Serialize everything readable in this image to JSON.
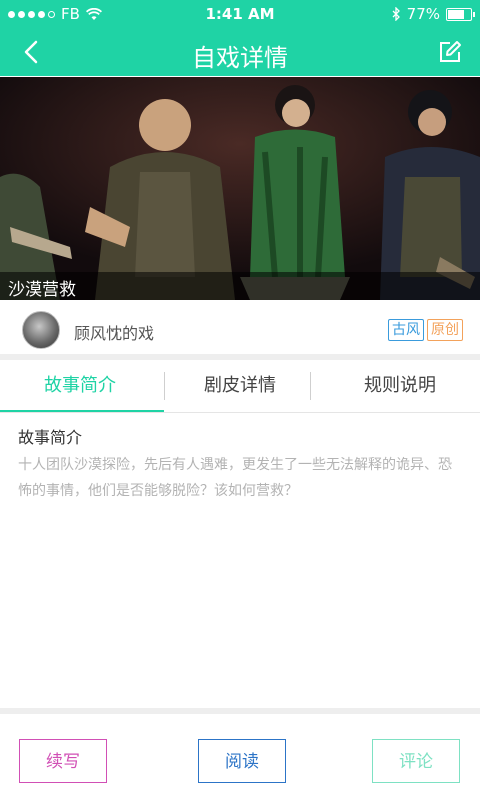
{
  "status_bar": {
    "carrier": "FB",
    "time": "1:41 AM",
    "battery_percent": "77%",
    "battery_level": 0.77,
    "signal_bars_filled": 4,
    "signal_bars_total": 5
  },
  "header": {
    "title": "自戏详情",
    "back_icon": "chevron-left-icon",
    "edit_icon": "edit-icon"
  },
  "hero": {
    "caption": "沙漠营救"
  },
  "author": {
    "name": "顾风忱的戏",
    "tags": [
      "古风",
      "原创"
    ]
  },
  "tabs": [
    {
      "label": "故事简介",
      "active": true
    },
    {
      "label": "剧皮详情",
      "active": false
    },
    {
      "label": "规则说明",
      "active": false
    }
  ],
  "intro": {
    "heading": "故事简介",
    "text": "十人团队沙漠探险，先后有人遇难，更发生了一些无法解释的诡异、恐怖的事情，他们是否能够脱险？该如何营救？"
  },
  "actions": {
    "continue_label": "续写",
    "read_label": "阅读",
    "comment_label": "评论"
  },
  "colors": {
    "accent": "#1fd3a5",
    "continue": "#d14fb5",
    "read": "#2c74c7",
    "comment": "#7ee1c3",
    "tag_blue": "#3a9bdc",
    "tag_orange": "#f3a25b"
  }
}
